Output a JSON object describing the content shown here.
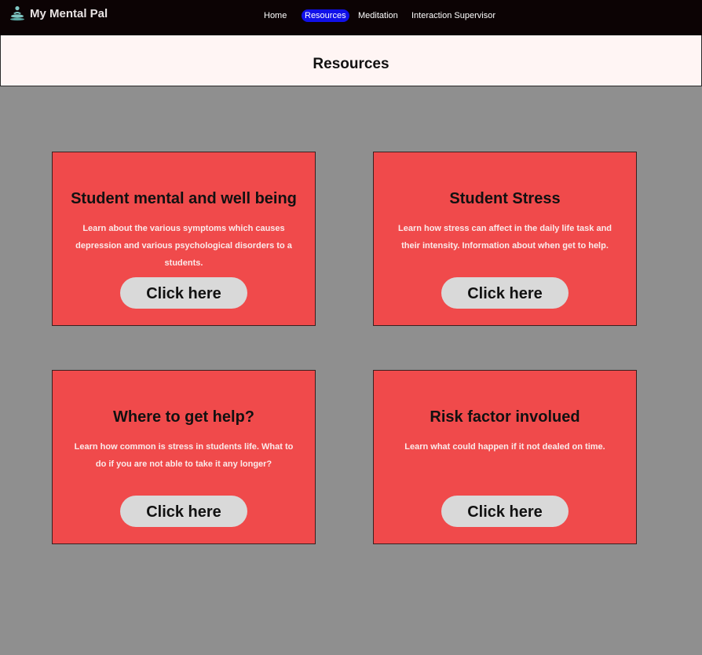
{
  "app": {
    "brand_name": "My Mental Pal",
    "brand_icon": "meditation-icon"
  },
  "nav": {
    "items": [
      {
        "label": "Home",
        "active": false
      },
      {
        "label": "Resources",
        "active": true
      },
      {
        "label": "Meditation",
        "active": false
      },
      {
        "label": "Interaction Supervisor",
        "active": false
      }
    ]
  },
  "header": {
    "title": "Resources"
  },
  "cards": [
    {
      "title": "Student mental and well being",
      "description": "Learn about the various symptoms which causes depression and various psychological disorders to a students.",
      "button_label": "Click here"
    },
    {
      "title": "Student Stress",
      "description": "Learn how stress can affect in the daily life task and their intensity. Information about when get to help.",
      "button_label": "Click here"
    },
    {
      "title": "Where to get help?",
      "description": "Learn how common is stress in students life. What to do if you are not able to take it any longer?",
      "button_label": "Click here"
    },
    {
      "title": "Risk factor involued",
      "description": "Learn what could happen if it not dealed on time.",
      "button_label": "Click here"
    }
  ],
  "colors": {
    "topbar": "#0c0304",
    "page_background": "#8f8f8f",
    "header_background": "#fff5f4",
    "card_background": "#f04a4b",
    "button_background": "#d9d9d9",
    "active_nav": "#1010e8"
  }
}
